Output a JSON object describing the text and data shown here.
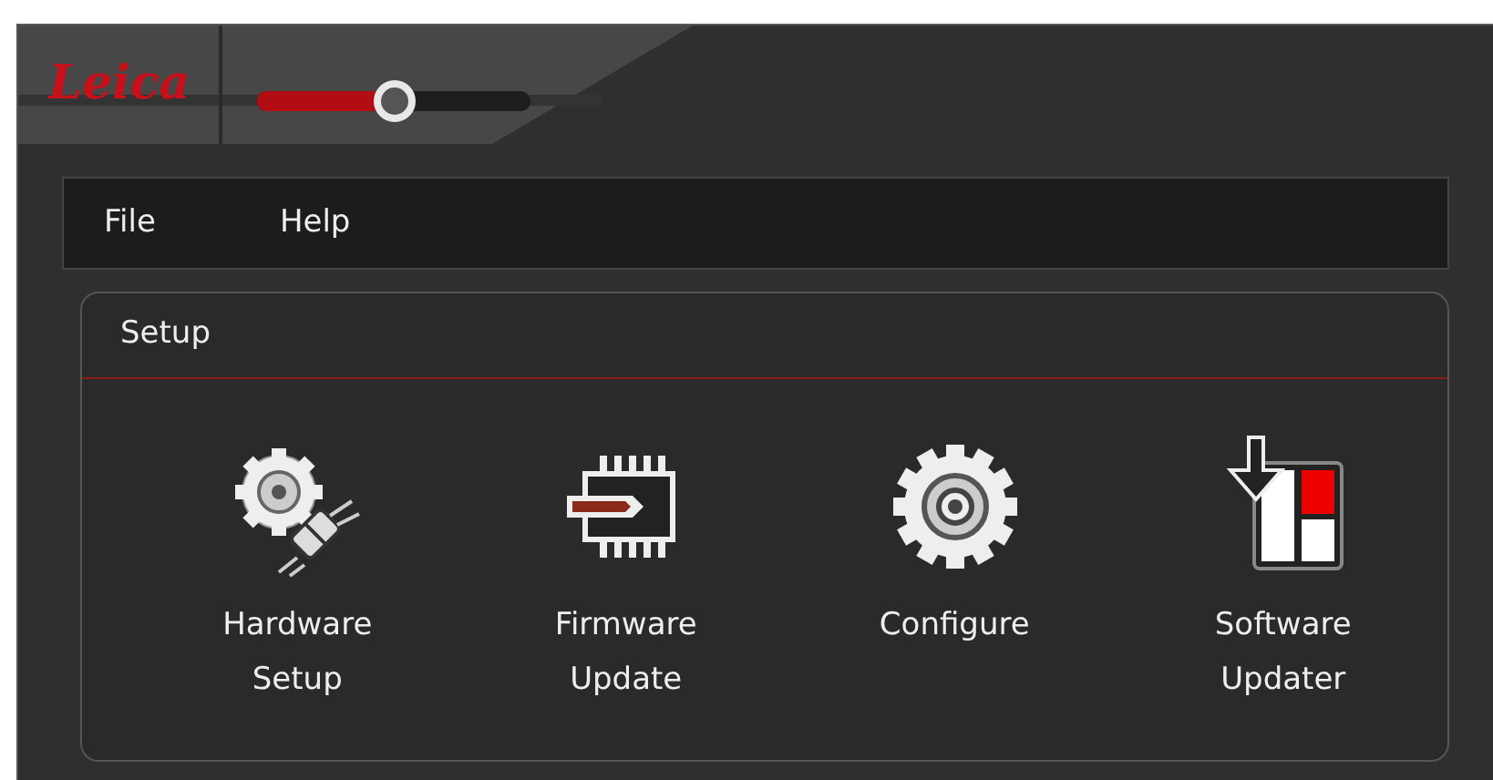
{
  "header": {
    "logo": "Leica",
    "slider": {
      "level": 0.5
    }
  },
  "menu": [
    "File",
    "Help"
  ],
  "panel": {
    "title": "Setup",
    "tools": [
      {
        "kind": "hardware",
        "label": "Hardware Setup"
      },
      {
        "kind": "firmware",
        "label": "Firmware Update"
      },
      {
        "kind": "configure",
        "label": "Configure"
      },
      {
        "kind": "software",
        "label": "Software Updater"
      }
    ]
  }
}
